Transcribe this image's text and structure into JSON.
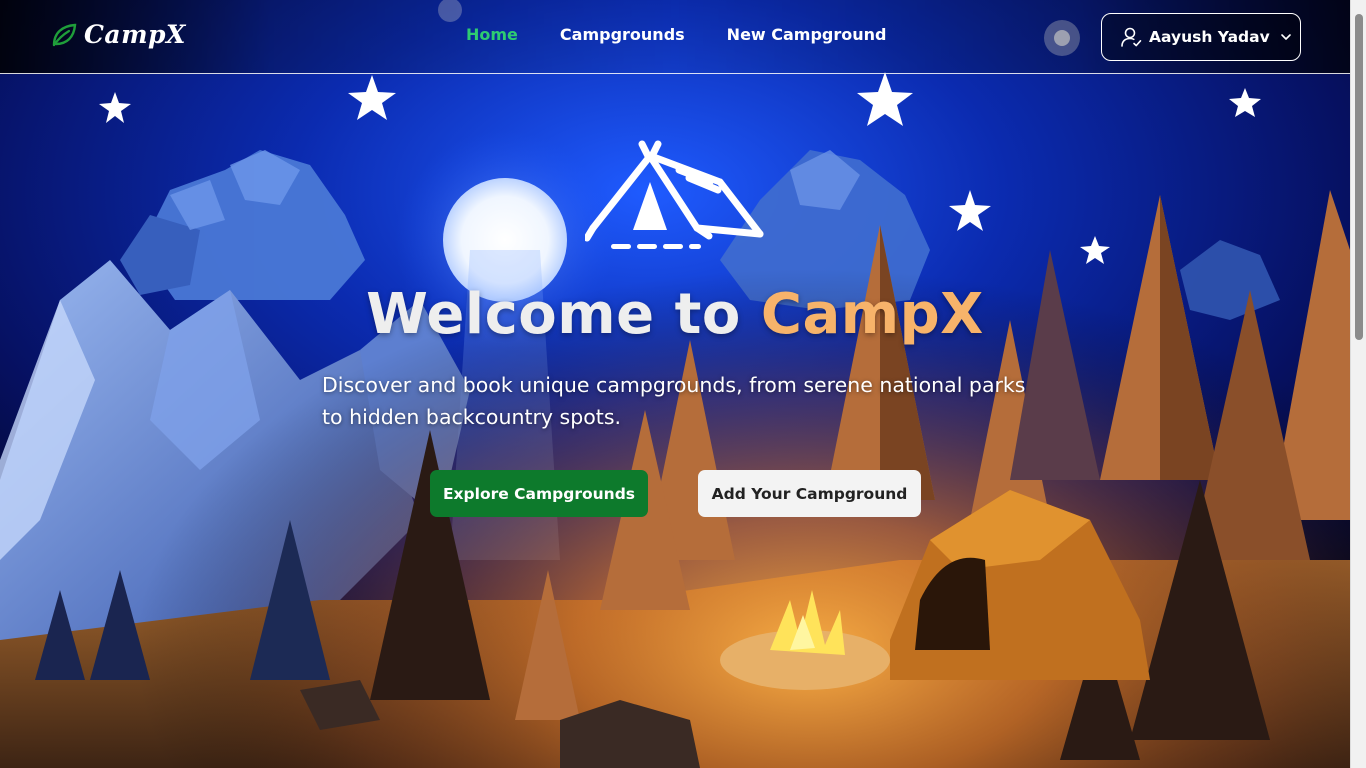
{
  "brand": {
    "name": "CampX",
    "icon": "leaf-icon"
  },
  "nav": {
    "links": [
      {
        "label": "Home",
        "active": true
      },
      {
        "label": "Campgrounds",
        "active": false
      },
      {
        "label": "New Campground",
        "active": false
      }
    ],
    "user": {
      "name": "Aayush Yadav",
      "icon": "user-check-icon",
      "dropdown_icon": "chevron-down-icon"
    }
  },
  "hero": {
    "icon": "tent-icon",
    "title_prefix": "Welcome to ",
    "title_accent": "CampX",
    "subtitle": "Discover and book unique campgrounds, from serene national parks to hidden backcountry spots.",
    "primary_button": "Explore Campgrounds",
    "secondary_button": "Add Your Campground"
  },
  "colors": {
    "accent_green": "#2ecc71",
    "button_green": "#0d7a2c",
    "title_accent": "#f7b36a",
    "button_light": "#f3f3f3"
  }
}
